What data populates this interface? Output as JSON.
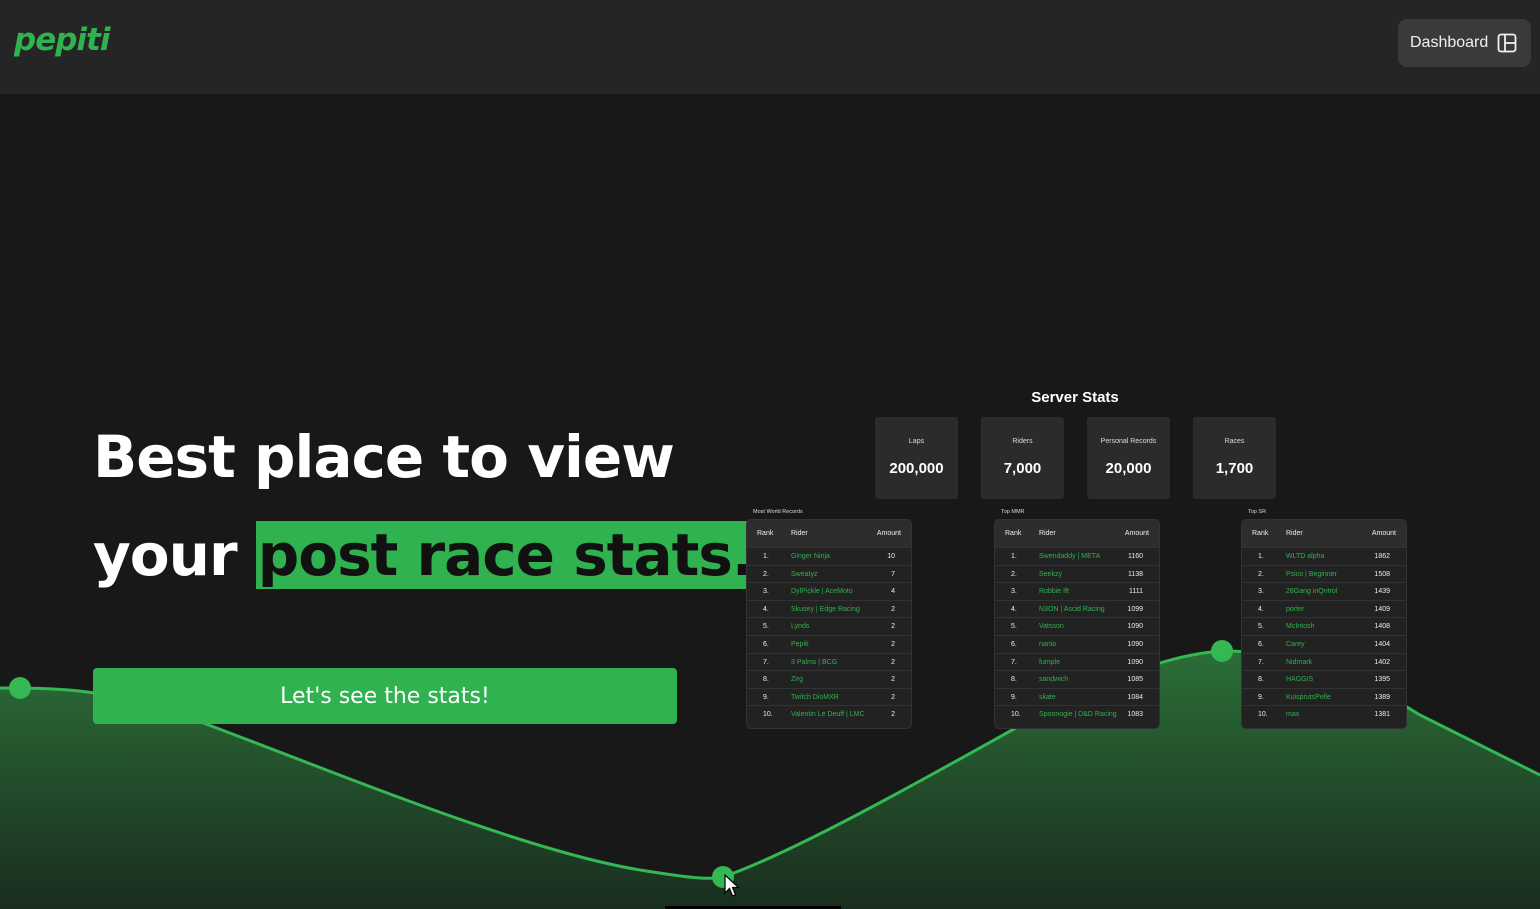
{
  "header": {
    "logo_text": "pepiti",
    "dashboard_label": "Dashboard",
    "dashboard_icon": "layout-icon"
  },
  "hero": {
    "title_line1": "Best place to view",
    "title_line2_prefix": "your ",
    "title_highlight": "post race stats.",
    "cta_label": "Let's see the stats!"
  },
  "server_stats": {
    "title": "Server Stats",
    "cards": [
      {
        "label": "Laps",
        "value": "200,000"
      },
      {
        "label": "Riders",
        "value": "7,000"
      },
      {
        "label": "Personal Records",
        "value": "20,000"
      },
      {
        "label": "Races",
        "value": "1,700"
      }
    ]
  },
  "tables": [
    {
      "caption": "Most World Records",
      "headers": {
        "rank": "Rank",
        "rider": "Rider",
        "amount": "Amount"
      },
      "rows": [
        {
          "rank": "1.",
          "rider": "Ginger Ninja",
          "amount": "10"
        },
        {
          "rank": "2.",
          "rider": "Sweatyz",
          "amount": "7"
        },
        {
          "rank": "3.",
          "rider": "DylPickle | AceMoto",
          "amount": "4"
        },
        {
          "rank": "4.",
          "rider": "Skusey | Edge Racing",
          "amount": "2"
        },
        {
          "rank": "5.",
          "rider": "Lynds",
          "amount": "2"
        },
        {
          "rank": "6.",
          "rider": "Pepiti",
          "amount": "2"
        },
        {
          "rank": "7.",
          "rider": "3 Palms | BCG",
          "amount": "2"
        },
        {
          "rank": "8.",
          "rider": "Zirg",
          "amount": "2"
        },
        {
          "rank": "9.",
          "rider": "Twitch DioMXR",
          "amount": "2"
        },
        {
          "rank": "10.",
          "rider": "Valentin Le Deuff | LMC",
          "amount": "2"
        }
      ]
    },
    {
      "caption": "Top MMR",
      "headers": {
        "rank": "Rank",
        "rider": "Rider",
        "amount": "Amount"
      },
      "rows": [
        {
          "rank": "1.",
          "rider": "Swendaddy | META",
          "amount": "1160"
        },
        {
          "rank": "2.",
          "rider": "Seekzy",
          "amount": "1138"
        },
        {
          "rank": "3.",
          "rider": "Robbie Ift",
          "amount": "1111"
        },
        {
          "rank": "4.",
          "rider": "N3ON | Ascid Racing",
          "amount": "1099"
        },
        {
          "rank": "5.",
          "rider": "Vatsson",
          "amount": "1090"
        },
        {
          "rank": "6.",
          "rider": "nanio",
          "amount": "1090"
        },
        {
          "rank": "7.",
          "rider": "fumple",
          "amount": "1090"
        },
        {
          "rank": "8.",
          "rider": "sandwich",
          "amount": "1085"
        },
        {
          "rank": "9.",
          "rider": "skate",
          "amount": "1084"
        },
        {
          "rank": "10.",
          "rider": "Spoonogie | D&D Racing",
          "amount": "1083"
        }
      ]
    },
    {
      "caption": "Top SR",
      "headers": {
        "rank": "Rank",
        "rider": "Rider",
        "amount": "Amount"
      },
      "rows": [
        {
          "rank": "1.",
          "rider": "WLTD alpha",
          "amount": "1862"
        },
        {
          "rank": "2.",
          "rider": "Psico | Beginner",
          "amount": "1508"
        },
        {
          "rank": "3.",
          "rider": "28Gang inQntrol",
          "amount": "1439"
        },
        {
          "rank": "4.",
          "rider": "porter",
          "amount": "1409"
        },
        {
          "rank": "5.",
          "rider": "McIntosh",
          "amount": "1408"
        },
        {
          "rank": "6.",
          "rider": "Carey",
          "amount": "1404"
        },
        {
          "rank": "7.",
          "rider": "Nidmark",
          "amount": "1402"
        },
        {
          "rank": "8.",
          "rider": "HAGGIS",
          "amount": "1395"
        },
        {
          "rank": "9.",
          "rider": "KuisprutsPelle",
          "amount": "1389"
        },
        {
          "rank": "10.",
          "rider": "max",
          "amount": "1381"
        }
      ]
    }
  ],
  "colors": {
    "accent": "#2fb24f",
    "background": "#181818",
    "header": "#252525"
  }
}
